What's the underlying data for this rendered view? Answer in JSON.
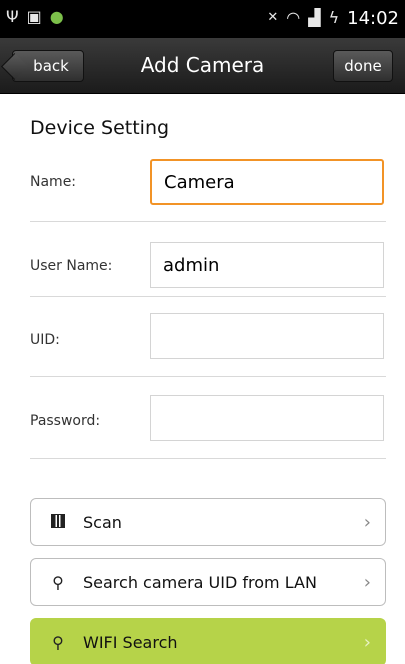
{
  "statusbar": {
    "time": "14:02",
    "left_icons": [
      "usb-icon",
      "sd-card-icon",
      "app-icon"
    ],
    "right_icons": [
      "mute-icon",
      "wifi-icon",
      "signal-icon",
      "battery-charging-icon"
    ]
  },
  "titlebar": {
    "title": "Add Camera",
    "back_label": "back",
    "done_label": "done"
  },
  "form": {
    "section_title": "Device Setting",
    "name_label": "Name:",
    "name_value": "Camera",
    "username_label": "User Name:",
    "username_value": "admin",
    "uid_label": "UID:",
    "uid_value": "",
    "password_label": "Password:",
    "password_value": ""
  },
  "actions": [
    {
      "label": "Scan",
      "icon": "qr-code-icon"
    },
    {
      "label": "Search camera UID from LAN",
      "icon": "search-icon"
    },
    {
      "label": "WIFI Search",
      "icon": "search-icon"
    }
  ],
  "colors": {
    "accent_focus": "#f29326",
    "wifi_button": "#b6d349",
    "titlebar": "#2a2a2a"
  }
}
